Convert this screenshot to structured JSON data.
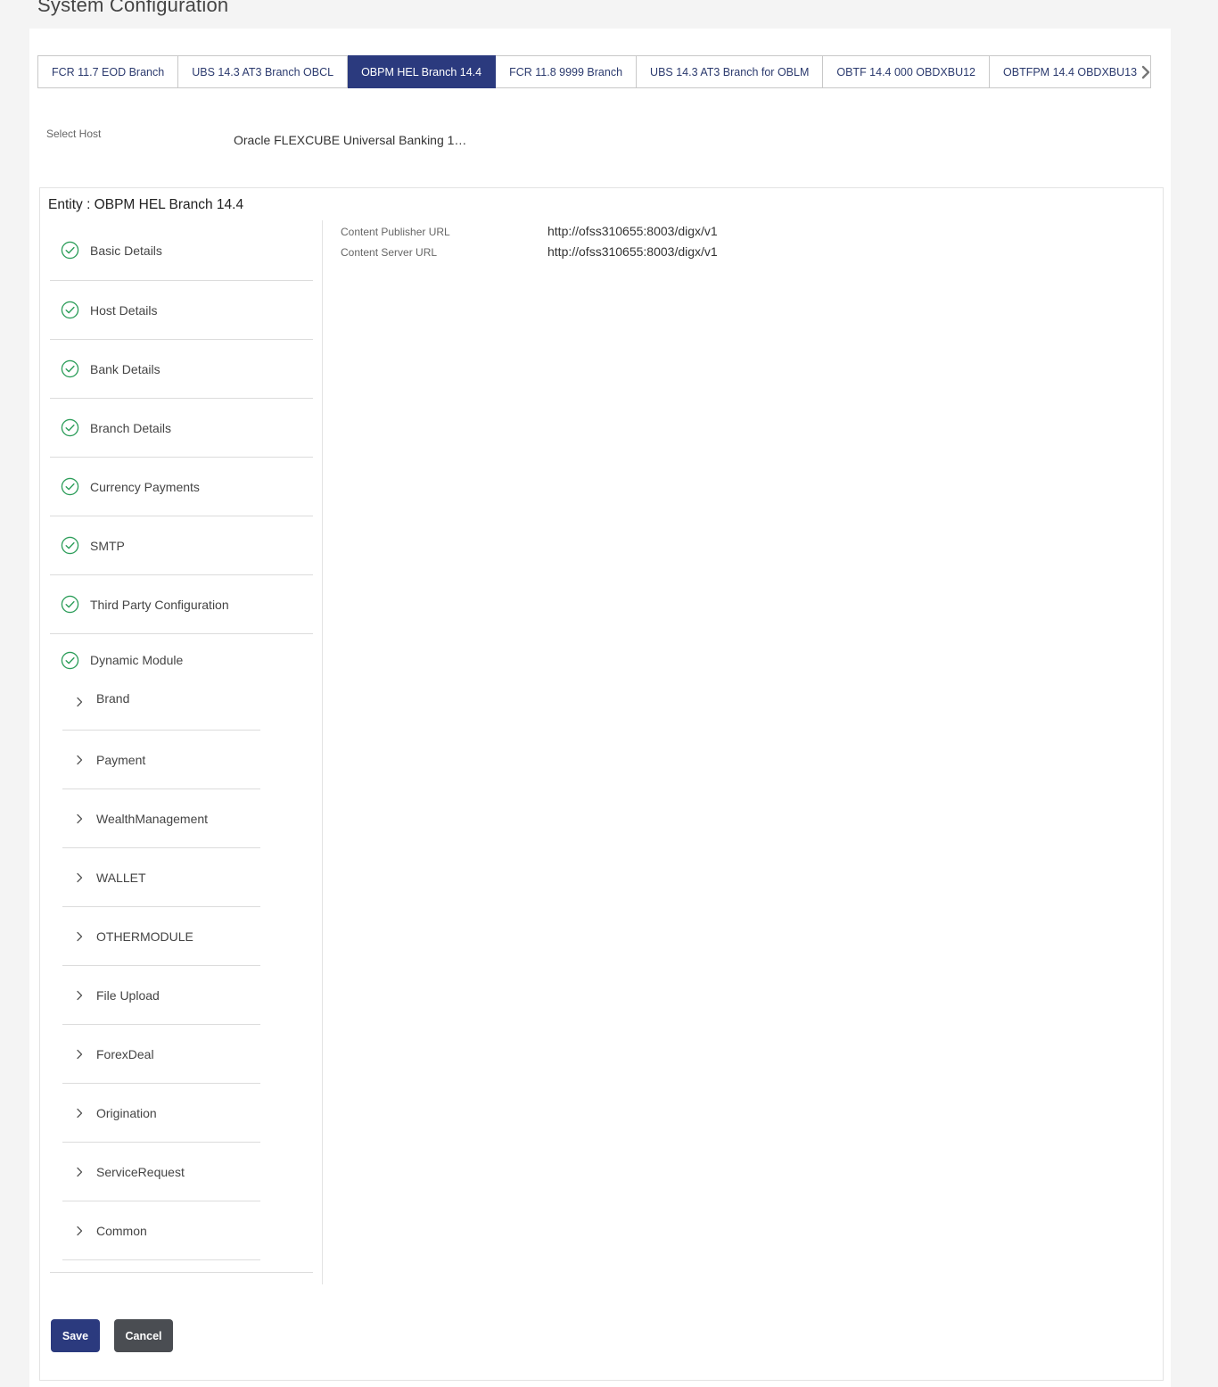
{
  "page": {
    "title": "System Configuration"
  },
  "tabs": [
    {
      "label": "FCR 11.7 EOD Branch",
      "active": false
    },
    {
      "label": "UBS 14.3 AT3 Branch OBCL",
      "active": false
    },
    {
      "label": "OBPM HEL Branch 14.4",
      "active": true
    },
    {
      "label": "FCR 11.8 9999 Branch",
      "active": false
    },
    {
      "label": "UBS 14.3 AT3 Branch for OBLM",
      "active": false
    },
    {
      "label": "OBTF 14.4 000 OBDXBU12",
      "active": false
    },
    {
      "label": "OBTFPM 14.4 OBDXBU13",
      "active": false
    }
  ],
  "host": {
    "label": "Select Host",
    "value": "Oracle FLEXCUBE Universal Banking 1…"
  },
  "entity": {
    "title": "Entity : OBPM HEL Branch 14.4"
  },
  "nav": {
    "items": [
      {
        "label": "Basic Details"
      },
      {
        "label": "Host Details"
      },
      {
        "label": "Bank Details"
      },
      {
        "label": "Branch Details"
      },
      {
        "label": "Currency Payments"
      },
      {
        "label": "SMTP"
      },
      {
        "label": "Third Party Configuration"
      }
    ],
    "dynamic": {
      "label": "Dynamic Module",
      "children": [
        {
          "label": "Brand"
        },
        {
          "label": "Payment"
        },
        {
          "label": "WealthManagement"
        },
        {
          "label": "WALLET"
        },
        {
          "label": "OTHERMODULE"
        },
        {
          "label": "File Upload"
        },
        {
          "label": "ForexDeal"
        },
        {
          "label": "Origination"
        },
        {
          "label": "ServiceRequest"
        },
        {
          "label": "Common"
        }
      ]
    }
  },
  "fields": [
    {
      "label": "Content Publisher URL",
      "value": "http://ofss310655:8003/digx/v1"
    },
    {
      "label": "Content Server URL",
      "value": "http://ofss310655:8003/digx/v1"
    }
  ],
  "actions": {
    "save_label": "Save",
    "cancel_label": "Cancel"
  },
  "colors": {
    "primary": "#2b3a7e",
    "success": "#2e9e5b",
    "cancel": "#4a4d52"
  }
}
